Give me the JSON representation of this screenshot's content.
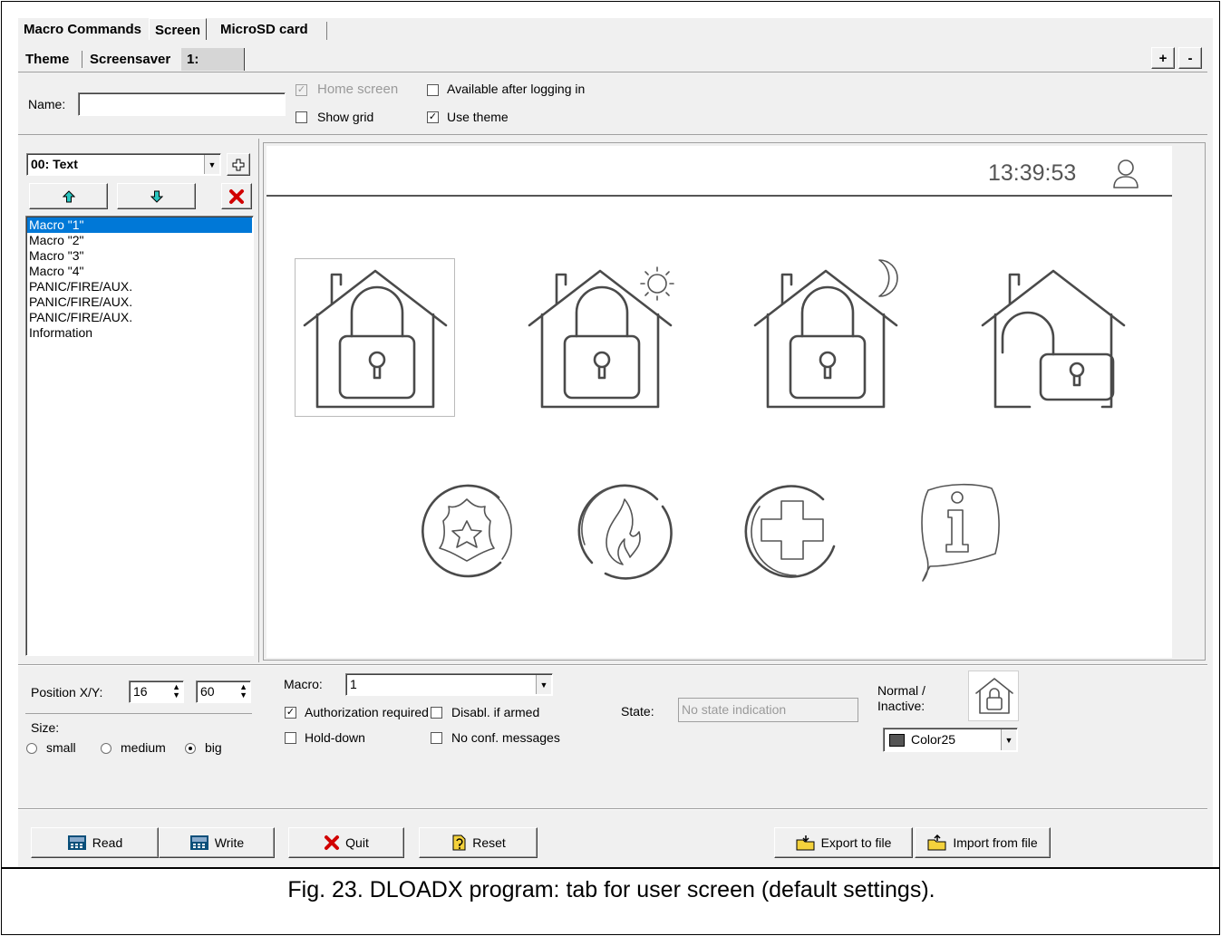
{
  "tabs": [
    "Macro Commands",
    "Screen",
    "MicroSD card"
  ],
  "subtabs": [
    "Theme",
    "Screensaver",
    "1:"
  ],
  "plus_label": "+",
  "minus_label": "-",
  "name_label": "Name:",
  "name_value": "",
  "options": {
    "home_screen": "Home screen",
    "available_after": "Available after logging in",
    "show_grid": "Show grid",
    "use_theme": "Use theme"
  },
  "element_select": "00: Text",
  "element_list": [
    "Macro \"1\"",
    "Macro \"2\"",
    "Macro \"3\"",
    "Macro \"4\"",
    "PANIC/FIRE/AUX.",
    "PANIC/FIRE/AUX.",
    "PANIC/FIRE/AUX.",
    "Information"
  ],
  "preview": {
    "time": "13:39:53"
  },
  "position": {
    "label": "Position X/Y:",
    "x": "16",
    "y": "60"
  },
  "size": {
    "label": "Size:",
    "small": "small",
    "medium": "medium",
    "big": "big",
    "selected": "big"
  },
  "macro": {
    "label": "Macro:",
    "value": "1"
  },
  "checks": {
    "auth": "Authorization required",
    "disabl": "Disabl. if armed",
    "hold": "Hold-down",
    "noconf": "No conf. messages"
  },
  "state": {
    "label": "State:",
    "value": "No state indication"
  },
  "normal_label": "Normal /",
  "inactive_label": "Inactive:",
  "color_value": "Color25",
  "color_swatch": "#555555",
  "buttons": {
    "read": "Read",
    "write": "Write",
    "quit": "Quit",
    "reset": "Reset",
    "export": "Export to file",
    "import": "Import from file"
  },
  "caption": "Fig. 23. DLOADX program: tab for user screen (default settings)."
}
